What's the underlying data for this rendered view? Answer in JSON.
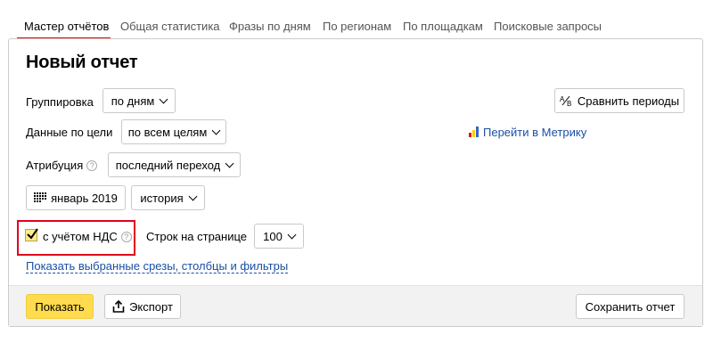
{
  "tabs": [
    {
      "label": "Мастер отчётов",
      "active": true
    },
    {
      "label": "Общая статистика",
      "active": false
    },
    {
      "label": "Фразы по дням",
      "active": false
    },
    {
      "label": "По регионам",
      "active": false
    },
    {
      "label": "По площадкам",
      "active": false
    },
    {
      "label": "Поисковые запросы",
      "active": false
    }
  ],
  "report": {
    "title": "Новый отчет",
    "grouping": {
      "label": "Группировка",
      "value": "по дням"
    },
    "goal_data": {
      "label": "Данные по цели",
      "value": "по всем целям"
    },
    "attribution": {
      "label": "Атрибуция",
      "help": "?",
      "value": "последний переход"
    },
    "period": {
      "value": "январь 2019"
    },
    "history": {
      "value": "история"
    },
    "vat": {
      "label": "с учётом НДС",
      "help": "?",
      "checked": true
    },
    "rows_per_page": {
      "label": "Строк на странице",
      "value": "100"
    },
    "compare_periods": {
      "label": "Сравнить периоды"
    },
    "metrika_link": {
      "label": "Перейти в Метрику"
    },
    "show_selected_link": {
      "label": "Показать выбранные срезы, столбцы и фильтры"
    }
  },
  "footer": {
    "show_label": "Показать",
    "export_label": "Экспорт",
    "save_label": "Сохранить отчет"
  },
  "colors": {
    "accent_red": "#ff0000",
    "highlight_red": "#e4001e",
    "link_blue": "#1a4fa5",
    "yellow_button": "#ffdb4d"
  }
}
